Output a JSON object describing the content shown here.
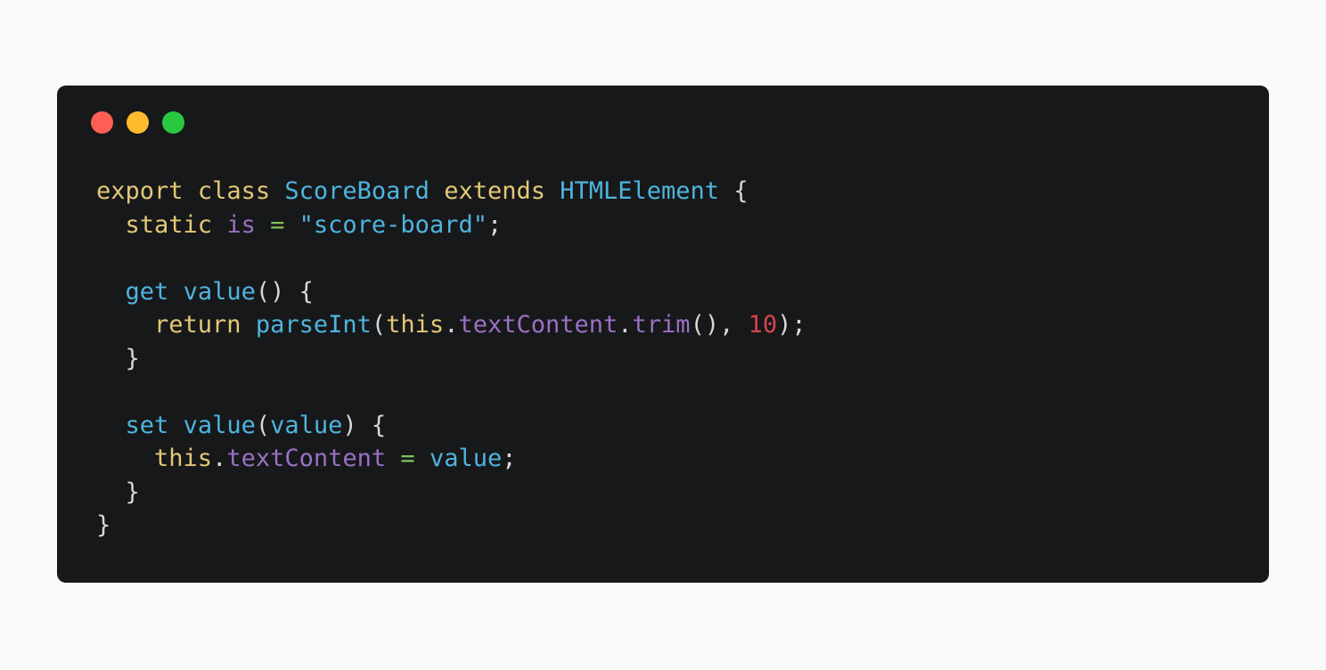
{
  "window": {
    "buttons": [
      {
        "name": "close",
        "color": "#fd5f57"
      },
      {
        "name": "minimize",
        "color": "#febb2e"
      },
      {
        "name": "maximize",
        "color": "#28c840"
      }
    ]
  },
  "code": {
    "lines": [
      [
        [
          "kw",
          "export"
        ],
        [
          "pu",
          " "
        ],
        [
          "kw",
          "class"
        ],
        [
          "pu",
          " "
        ],
        [
          "ty",
          "ScoreBoard"
        ],
        [
          "pu",
          " "
        ],
        [
          "kw",
          "extends"
        ],
        [
          "pu",
          " "
        ],
        [
          "ty",
          "HTMLElement"
        ],
        [
          "pu",
          " {"
        ]
      ],
      [
        [
          "pu",
          "  "
        ],
        [
          "kw",
          "static"
        ],
        [
          "pu",
          " "
        ],
        [
          "pr",
          "is"
        ],
        [
          "pu",
          " "
        ],
        [
          "op",
          "="
        ],
        [
          "pu",
          " "
        ],
        [
          "st",
          "\"score-board\""
        ],
        [
          "pu",
          ";"
        ]
      ],
      [],
      [
        [
          "pu",
          "  "
        ],
        [
          "fn",
          "get"
        ],
        [
          "pu",
          " "
        ],
        [
          "fn",
          "value"
        ],
        [
          "pu",
          "() {"
        ]
      ],
      [
        [
          "pu",
          "    "
        ],
        [
          "kw",
          "return"
        ],
        [
          "pu",
          " "
        ],
        [
          "fn",
          "parseInt"
        ],
        [
          "pu",
          "("
        ],
        [
          "kw",
          "this"
        ],
        [
          "pu",
          "."
        ],
        [
          "pr",
          "textContent"
        ],
        [
          "pu",
          "."
        ],
        [
          "pr",
          "trim"
        ],
        [
          "pu",
          "(), "
        ],
        [
          "nu",
          "10"
        ],
        [
          "pu",
          ");"
        ]
      ],
      [
        [
          "pu",
          "  }"
        ]
      ],
      [],
      [
        [
          "pu",
          "  "
        ],
        [
          "fn",
          "set"
        ],
        [
          "pu",
          " "
        ],
        [
          "fn",
          "value"
        ],
        [
          "pu",
          "("
        ],
        [
          "fn",
          "value"
        ],
        [
          "pu",
          ") {"
        ]
      ],
      [
        [
          "pu",
          "    "
        ],
        [
          "kw",
          "this"
        ],
        [
          "pu",
          "."
        ],
        [
          "pr",
          "textContent"
        ],
        [
          "pu",
          " "
        ],
        [
          "op",
          "="
        ],
        [
          "pu",
          " "
        ],
        [
          "fn",
          "value"
        ],
        [
          "pu",
          ";"
        ]
      ],
      [
        [
          "pu",
          "  }"
        ]
      ],
      [
        [
          "pu",
          "}"
        ]
      ]
    ]
  }
}
